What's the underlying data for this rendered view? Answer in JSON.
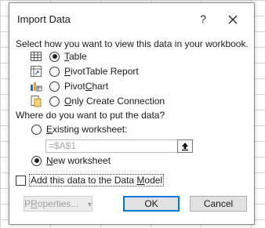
{
  "dialog": {
    "title": "Import Data",
    "help_label": "?",
    "close_label": "✕"
  },
  "view_section": {
    "heading": "Select how you want to view this data in your workbook.",
    "options": [
      {
        "key": "T",
        "rest": "able",
        "selected": true,
        "icon": "table-icon"
      },
      {
        "key": "P",
        "rest": "ivotTable Report",
        "selected": false,
        "icon": "pivottable-icon"
      },
      {
        "pre": "Pivot",
        "key": "C",
        "rest": "hart",
        "selected": false,
        "icon": "pivotchart-icon"
      },
      {
        "key": "O",
        "rest": "nly Create Connection",
        "selected": false,
        "icon": "connection-icon"
      }
    ]
  },
  "location_section": {
    "heading": "Where do you want to put the data?",
    "existing": {
      "key": "E",
      "rest": "xisting worksheet:",
      "selected": false
    },
    "reference_value": "=$A$1",
    "collapse_icon": "collapse-dialog-icon",
    "new": {
      "key": "N",
      "rest": "ew worksheet",
      "selected": true
    }
  },
  "data_model": {
    "pre": "Add this data to the Data ",
    "key": "M",
    "rest": "odel",
    "checked": false
  },
  "buttons": {
    "properties_key": "R",
    "properties_pre": "P",
    "properties_rest": "operties...",
    "properties_arrow": "▾",
    "ok_label": "OK",
    "cancel_label": "Cancel"
  }
}
